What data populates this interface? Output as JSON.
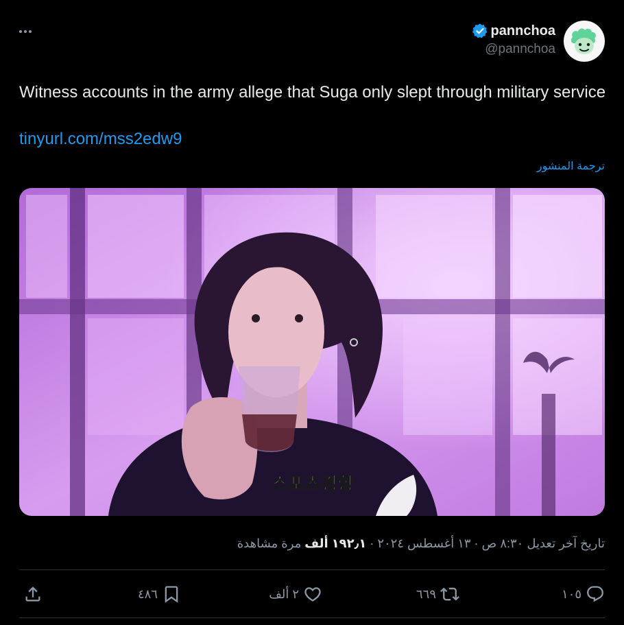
{
  "author": {
    "display_name": "pannchoa",
    "handle": "@pannchoa",
    "verified_icon": "verified-badge-icon",
    "avatar_icon": "green-character-avatar"
  },
  "tweet": {
    "text": "Witness accounts in the army allege that Suga only slept through military service",
    "link": "tinyurl.com/mss2edw9",
    "translate_label": "ترجمة المنشور",
    "media_watermark": "스포츠경향"
  },
  "meta": {
    "prefix": "تاريخ آخر تعديل ٨:٣٠ ص · ١٣ أغسطس ٢٠٢٤ · ",
    "views_count": "١٩٢٫١ ألف",
    "views_suffix": " مرة مشاهدة"
  },
  "actions": {
    "reply_count": "١٠٥",
    "repost_count": "٦٦٩",
    "like_count": "٢ ألف",
    "bookmark_count": "٤٨٦"
  },
  "colors": {
    "background": "#000000",
    "accent": "#1d9bf0",
    "muted": "#8b98a5",
    "text": "#e7e9ea"
  }
}
